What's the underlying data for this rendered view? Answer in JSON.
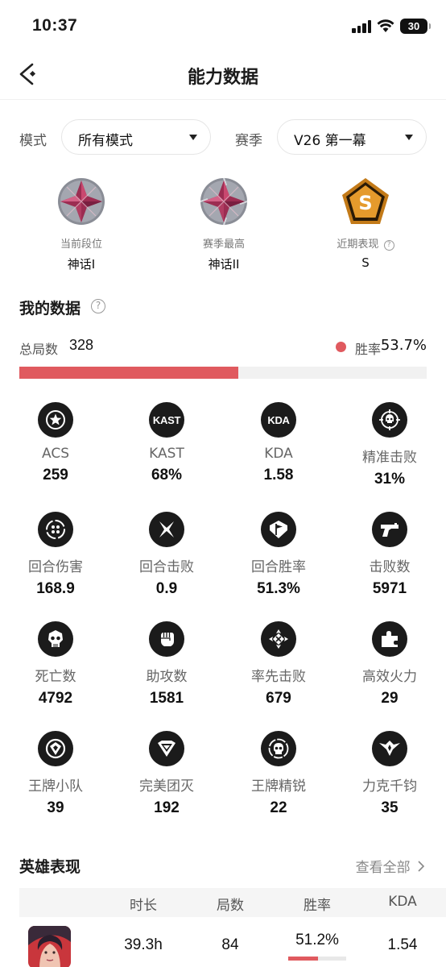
{
  "status": {
    "time": "10:37",
    "battery": "30"
  },
  "nav": {
    "title": "能力数据"
  },
  "filters": {
    "mode_label": "模式",
    "mode_value": "所有模式",
    "season_label": "赛季",
    "season_value": "V26 第一幕"
  },
  "ranks": [
    {
      "label": "当前段位",
      "value": "神话I",
      "emblem": "mythic-rank-icon"
    },
    {
      "label": "赛季最高",
      "value": "神话II",
      "emblem": "mythic-rank-icon"
    },
    {
      "label": "近期表现",
      "value": "S",
      "emblem": "s-grade-badge-icon",
      "badge_letter": "S"
    }
  ],
  "my_data": {
    "title": "我的数据",
    "total_label": "总局数",
    "total_value": "328",
    "win_label": "胜率",
    "win_value": "53.7%",
    "win_fraction": 0.537
  },
  "stats": [
    {
      "label": "ACS",
      "value": "259",
      "icon": "star-icon"
    },
    {
      "label": "KAST",
      "value": "68%",
      "icon": "kast-icon",
      "icon_text": "KAST"
    },
    {
      "label": "KDA",
      "value": "1.58",
      "icon": "kda-icon",
      "icon_text": "KDA"
    },
    {
      "label": "精准击败",
      "value": "31%",
      "icon": "crosshair-skull-icon"
    },
    {
      "label": "回合伤害",
      "value": "168.9",
      "icon": "damage-icon"
    },
    {
      "label": "回合击败",
      "value": "0.9",
      "icon": "crossed-blades-icon"
    },
    {
      "label": "回合胜率",
      "value": "51.3%",
      "icon": "flag-icon"
    },
    {
      "label": "击败数",
      "value": "5971",
      "icon": "gun-icon"
    },
    {
      "label": "死亡数",
      "value": "4792",
      "icon": "skull-icon"
    },
    {
      "label": "助攻数",
      "value": "1581",
      "icon": "fist-icon"
    },
    {
      "label": "率先击败",
      "value": "679",
      "icon": "first-blood-icon"
    },
    {
      "label": "高效火力",
      "value": "29",
      "icon": "puzzle-icon"
    },
    {
      "label": "王牌小队",
      "value": "39",
      "icon": "ace-team-icon"
    },
    {
      "label": "完美团灭",
      "value": "192",
      "icon": "diamond-shield-icon"
    },
    {
      "label": "王牌精锐",
      "value": "22",
      "icon": "elite-skull-icon"
    },
    {
      "label": "力克千钧",
      "value": "35",
      "icon": "eagle-icon"
    }
  ],
  "heroes": {
    "title": "英雄表现",
    "view_all": "查看全部",
    "columns": [
      "时长",
      "局数",
      "胜率",
      "KDA"
    ],
    "rows": [
      {
        "duration": "39.3h",
        "matches": "84",
        "win_rate": "51.2%",
        "win_fraction": 0.512,
        "kda": "1.54",
        "avatar": "hero-avatar"
      }
    ]
  },
  "colors": {
    "accent": "#e05a5f",
    "icon_bg": "#1b1b1b",
    "gold": "#e0a030"
  }
}
